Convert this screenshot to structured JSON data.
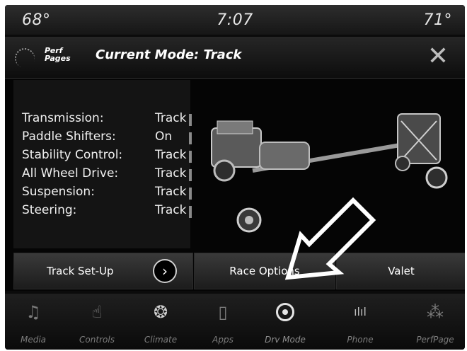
{
  "status": {
    "temp_left": "68°",
    "time": "7:07",
    "temp_right": "71°"
  },
  "header": {
    "logo_line1": "Perf",
    "logo_line2": "Pages",
    "title": "Current Mode: Track",
    "close_glyph": "✕"
  },
  "settings": [
    {
      "label": "Transmission:",
      "value": "Track"
    },
    {
      "label": "Paddle Shifters:",
      "value": "On"
    },
    {
      "label": "Stability Control:",
      "value": "Track"
    },
    {
      "label": "All Wheel Drive:",
      "value": "Track"
    },
    {
      "label": "Suspension:",
      "value": "Track"
    },
    {
      "label": "Steering:",
      "value": "Track"
    }
  ],
  "buttons": {
    "track_setup": "Track Set-Up",
    "track_setup_arrow": "›",
    "race_options": "Race Options",
    "valet": "Valet"
  },
  "nav": [
    {
      "label": "Media",
      "icon": "music-note-icon",
      "glyph": "♫"
    },
    {
      "label": "Controls",
      "icon": "hand-icon",
      "glyph": "☝"
    },
    {
      "label": "Climate",
      "icon": "climate-icon",
      "glyph": "❂"
    },
    {
      "label": "Apps",
      "icon": "apps-icon",
      "glyph": "▯"
    },
    {
      "label": "Drv Mode",
      "icon": "steering-wheel-icon",
      "glyph": ""
    },
    {
      "label": "Phone",
      "icon": "phone-signal-icon",
      "glyph": "ılıl"
    },
    {
      "label": "PerfPage",
      "icon": "perf-gauge-icon",
      "glyph": "⁂"
    }
  ],
  "active_nav": "Drv Mode"
}
